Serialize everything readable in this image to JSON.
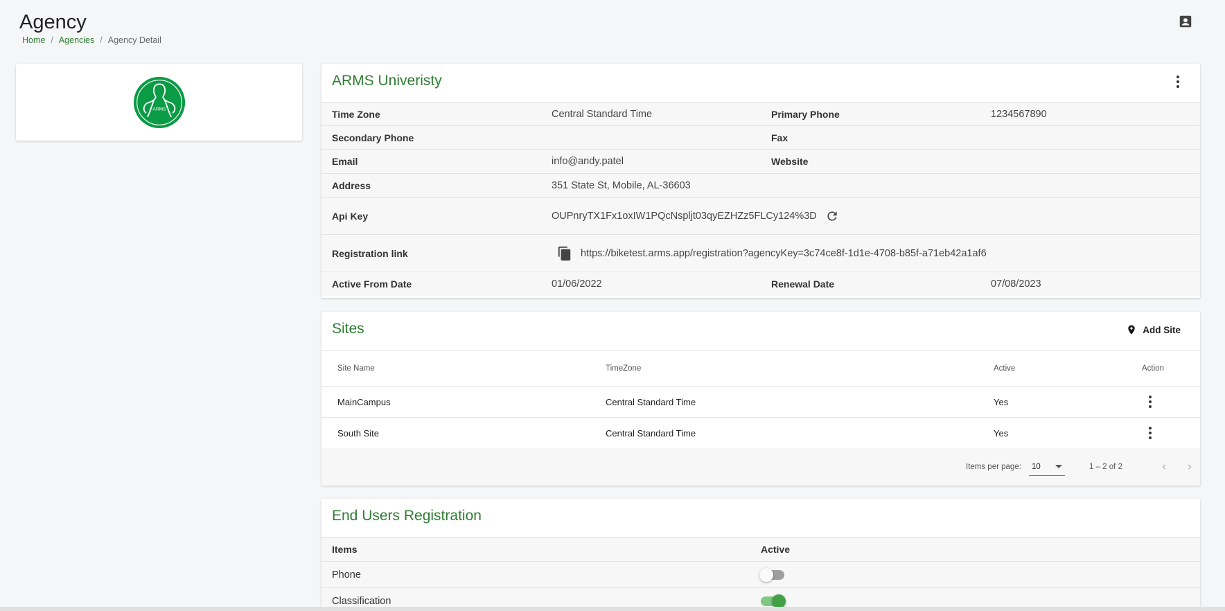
{
  "header": {
    "title": "Agency",
    "breadcrumb": [
      "Home",
      "Agencies",
      "Agency Detail"
    ],
    "breadcrumb_sep": "/"
  },
  "agency": {
    "name": "ARMS Univeristy",
    "logo_text": "ARMS",
    "details": [
      {
        "label": "Time Zone",
        "value": "Central Standard Time",
        "label2": "Primary Phone",
        "value2": "1234567890"
      },
      {
        "label": "Secondary Phone",
        "value": "",
        "label2": "Fax",
        "value2": ""
      },
      {
        "label": "Email",
        "value": "info@andy.patel",
        "label2": "Website",
        "value2": ""
      },
      {
        "label": "Address",
        "value": "351 State St, Mobile, AL-36603"
      },
      {
        "label": "Api Key",
        "value": "OUPnryTX1Fx1oxIW1PQcNspljt03qyEZHZz5FLCy124%3D"
      },
      {
        "label": "Registration link",
        "value": "https://biketest.arms.app/registration?agencyKey=3c74ce8f-1d1e-4708-b85f-a71eb42a1af6"
      },
      {
        "label": "Active From Date",
        "value": "01/06/2022",
        "label2": "Renewal Date",
        "value2": "07/08/2023"
      }
    ]
  },
  "sites": {
    "title": "Sites",
    "add_label": "Add Site",
    "columns": [
      "Site Name",
      "TimeZone",
      "Active",
      "Action"
    ],
    "rows": [
      {
        "name": "MainCampus",
        "timezone": "Central Standard Time",
        "active": "Yes"
      },
      {
        "name": "South Site",
        "timezone": "Central Standard Time",
        "active": "Yes"
      }
    ],
    "paginator": {
      "label": "Items per page:",
      "page_size": "10",
      "range": "1 – 2 of 2"
    }
  },
  "end_users": {
    "title": "End Users Registration",
    "columns": [
      "Items",
      "Active"
    ],
    "rows": [
      {
        "item": "Phone",
        "active": false
      },
      {
        "item": "Classification",
        "active": true
      }
    ]
  },
  "colors": {
    "accent": "#2e7d32",
    "logo_green": "#0a9b45"
  },
  "icons": {
    "user": "person-icon",
    "more": "more-vert-icon",
    "refresh": "refresh-icon",
    "copy": "copy-icon",
    "add_location": "add-location-icon"
  }
}
